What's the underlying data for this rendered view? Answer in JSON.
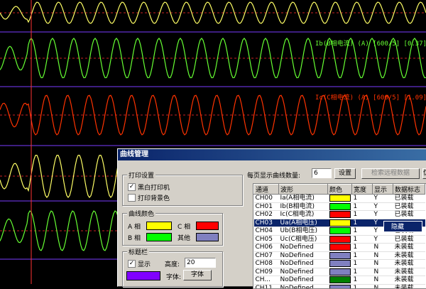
{
  "channels": [
    {
      "label": "",
      "color": "#ffff66"
    },
    {
      "label": "Ib(B相电流) (A) [600/5] [0.37] [",
      "color": "#66ff33"
    },
    {
      "label": "Ic(C相电流) (A) [600/5] [1.09] [",
      "color": "#ff3300"
    },
    {
      "label": "",
      "color": "#ffff66"
    },
    {
      "label": "",
      "color": "#66ff33"
    }
  ],
  "dialog": {
    "title": "曲线管理",
    "print_settings": {
      "title": "打印设置",
      "bw_printer": {
        "label": "黑白打印机",
        "checked": "✓"
      },
      "print_bg": {
        "label": "打印背景色",
        "checked": ""
      }
    },
    "curve_colors": {
      "title": "曲线颜色",
      "a_label": "A 相",
      "a_color": "#ffff00",
      "c_label": "C 相",
      "c_color": "#ff0000",
      "b_label": "B 相",
      "b_color": "#00ff00",
      "other_label": "其他",
      "other_color": "#8080c0"
    },
    "title_bar": {
      "title": "标题栏",
      "show": {
        "label": "显示",
        "checked": "✓"
      },
      "height_label": "高度:",
      "height_value": "20",
      "font_color": "#8000ff",
      "font_label": "字体:",
      "font_button": "字体"
    },
    "top_controls": {
      "per_page_label": "每页显示曲线数量:",
      "per_page_value": "6",
      "set_button": "设置",
      "search_button": "检索远程数据",
      "extra_button": "优"
    },
    "table": {
      "headers": [
        "通道",
        "波形",
        "颜色",
        "宽度",
        "显示",
        "数据标志"
      ],
      "rows": [
        {
          "ch": "CH00",
          "wave": "Ia(A相电流)",
          "color": "#ffff00",
          "width": "1",
          "show": "Y",
          "flag": "已装载"
        },
        {
          "ch": "CH01",
          "wave": "Ib(B相电流)",
          "color": "#00ff00",
          "width": "1",
          "show": "Y",
          "flag": "已装载"
        },
        {
          "ch": "CH02",
          "wave": "Ic(C相电流)",
          "color": "#ff0000",
          "width": "1",
          "show": "Y",
          "flag": "已装载"
        },
        {
          "ch": "CH03",
          "wave": "Ua(A相电压)",
          "color": "#ffff00",
          "width": "1",
          "show": "Y",
          "flag": "",
          "selected": true
        },
        {
          "ch": "CH04",
          "wave": "Ub(B相电压)",
          "color": "#00ff00",
          "width": "1",
          "show": "Y",
          "flag": "已装载"
        },
        {
          "ch": "CH05",
          "wave": "Uc(C相电压)",
          "color": "#ff0000",
          "width": "1",
          "show": "Y",
          "flag": "已装载"
        },
        {
          "ch": "CH06",
          "wave": "NoDefined",
          "color": "#ff0000",
          "width": "1",
          "show": "N",
          "flag": "未装载"
        },
        {
          "ch": "CH07",
          "wave": "NoDefined",
          "color": "#8080c0",
          "width": "1",
          "show": "N",
          "flag": "未装载"
        },
        {
          "ch": "CH08",
          "wave": "NoDefined",
          "color": "#8080c0",
          "width": "1",
          "show": "N",
          "flag": "未装载"
        },
        {
          "ch": "CH09",
          "wave": "NoDefined",
          "color": "#8080c0",
          "width": "1",
          "show": "N",
          "flag": "未装载"
        },
        {
          "ch": "CH...",
          "wave": "NoDefined",
          "color": "#008000",
          "width": "1",
          "show": "N",
          "flag": "未装载"
        },
        {
          "ch": "CH11",
          "wave": "NoDefined",
          "color": "#8080c0",
          "width": "1",
          "show": "N",
          "flag": "未装载"
        }
      ]
    },
    "context_menu": {
      "hide": "隐藏"
    }
  }
}
